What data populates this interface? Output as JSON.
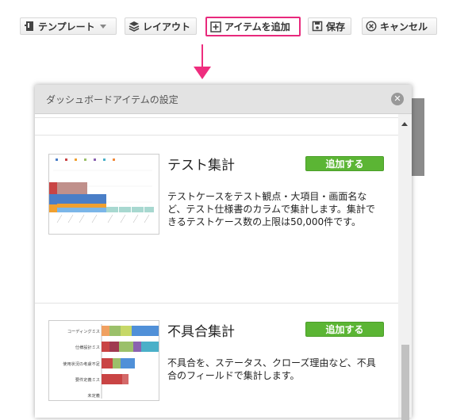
{
  "toolbar": {
    "template_label": "テンプレート",
    "layout_label": "レイアウト",
    "add_item_label": "アイテムを追加",
    "save_label": "保存",
    "cancel_label": "キャンセル"
  },
  "dialog": {
    "title": "ダッシュボードアイテムの設定",
    "items": [
      {
        "title": "テスト集計",
        "add_label": "追加する",
        "description": "テストケースをテスト観点・大項目・画面名など、テスト仕様書のカラムで集計します。集計できるテストケース数の上限は50,000件です。"
      },
      {
        "title": "不具合集計",
        "add_label": "追加する",
        "description": "不具合を、ステータス、クローズ理由など、不具合のフィールドで集計します。",
        "chart_labels": [
          "コーディングミス",
          "仕様設計ミス",
          "使用状況の考慮不足",
          "要件定義ミス",
          "未定義"
        ]
      }
    ]
  },
  "colors": {
    "accent_highlight": "#e8297c",
    "add_button": "#5bb534"
  }
}
